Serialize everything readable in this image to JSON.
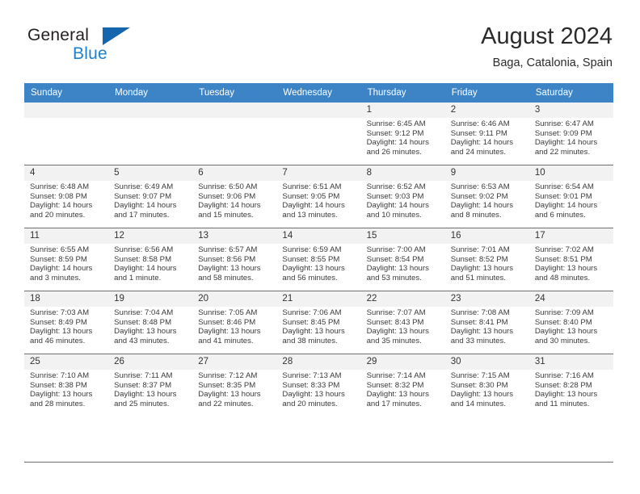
{
  "brand": {
    "name_top": "General",
    "name_bottom": "Blue",
    "flag_icon": "triangle-flag-icon",
    "accent_color": "#1d7fd0"
  },
  "header": {
    "title": "August 2024",
    "location": "Baga, Catalonia, Spain"
  },
  "calendar": {
    "header_bg": "#3c84c6",
    "daynum_bg": "#f2f2f2",
    "weekdays": [
      "Sunday",
      "Monday",
      "Tuesday",
      "Wednesday",
      "Thursday",
      "Friday",
      "Saturday"
    ],
    "weeks": [
      [
        {
          "day": "",
          "empty": true
        },
        {
          "day": "",
          "empty": true
        },
        {
          "day": "",
          "empty": true
        },
        {
          "day": "",
          "empty": true
        },
        {
          "day": "1",
          "sunrise": "Sunrise: 6:45 AM",
          "sunset": "Sunset: 9:12 PM",
          "daylight1": "Daylight: 14 hours",
          "daylight2": "and 26 minutes."
        },
        {
          "day": "2",
          "sunrise": "Sunrise: 6:46 AM",
          "sunset": "Sunset: 9:11 PM",
          "daylight1": "Daylight: 14 hours",
          "daylight2": "and 24 minutes."
        },
        {
          "day": "3",
          "sunrise": "Sunrise: 6:47 AM",
          "sunset": "Sunset: 9:09 PM",
          "daylight1": "Daylight: 14 hours",
          "daylight2": "and 22 minutes."
        }
      ],
      [
        {
          "day": "4",
          "sunrise": "Sunrise: 6:48 AM",
          "sunset": "Sunset: 9:08 PM",
          "daylight1": "Daylight: 14 hours",
          "daylight2": "and 20 minutes."
        },
        {
          "day": "5",
          "sunrise": "Sunrise: 6:49 AM",
          "sunset": "Sunset: 9:07 PM",
          "daylight1": "Daylight: 14 hours",
          "daylight2": "and 17 minutes."
        },
        {
          "day": "6",
          "sunrise": "Sunrise: 6:50 AM",
          "sunset": "Sunset: 9:06 PM",
          "daylight1": "Daylight: 14 hours",
          "daylight2": "and 15 minutes."
        },
        {
          "day": "7",
          "sunrise": "Sunrise: 6:51 AM",
          "sunset": "Sunset: 9:05 PM",
          "daylight1": "Daylight: 14 hours",
          "daylight2": "and 13 minutes."
        },
        {
          "day": "8",
          "sunrise": "Sunrise: 6:52 AM",
          "sunset": "Sunset: 9:03 PM",
          "daylight1": "Daylight: 14 hours",
          "daylight2": "and 10 minutes."
        },
        {
          "day": "9",
          "sunrise": "Sunrise: 6:53 AM",
          "sunset": "Sunset: 9:02 PM",
          "daylight1": "Daylight: 14 hours",
          "daylight2": "and 8 minutes."
        },
        {
          "day": "10",
          "sunrise": "Sunrise: 6:54 AM",
          "sunset": "Sunset: 9:01 PM",
          "daylight1": "Daylight: 14 hours",
          "daylight2": "and 6 minutes."
        }
      ],
      [
        {
          "day": "11",
          "sunrise": "Sunrise: 6:55 AM",
          "sunset": "Sunset: 8:59 PM",
          "daylight1": "Daylight: 14 hours",
          "daylight2": "and 3 minutes."
        },
        {
          "day": "12",
          "sunrise": "Sunrise: 6:56 AM",
          "sunset": "Sunset: 8:58 PM",
          "daylight1": "Daylight: 14 hours",
          "daylight2": "and 1 minute."
        },
        {
          "day": "13",
          "sunrise": "Sunrise: 6:57 AM",
          "sunset": "Sunset: 8:56 PM",
          "daylight1": "Daylight: 13 hours",
          "daylight2": "and 58 minutes."
        },
        {
          "day": "14",
          "sunrise": "Sunrise: 6:59 AM",
          "sunset": "Sunset: 8:55 PM",
          "daylight1": "Daylight: 13 hours",
          "daylight2": "and 56 minutes."
        },
        {
          "day": "15",
          "sunrise": "Sunrise: 7:00 AM",
          "sunset": "Sunset: 8:54 PM",
          "daylight1": "Daylight: 13 hours",
          "daylight2": "and 53 minutes."
        },
        {
          "day": "16",
          "sunrise": "Sunrise: 7:01 AM",
          "sunset": "Sunset: 8:52 PM",
          "daylight1": "Daylight: 13 hours",
          "daylight2": "and 51 minutes."
        },
        {
          "day": "17",
          "sunrise": "Sunrise: 7:02 AM",
          "sunset": "Sunset: 8:51 PM",
          "daylight1": "Daylight: 13 hours",
          "daylight2": "and 48 minutes."
        }
      ],
      [
        {
          "day": "18",
          "sunrise": "Sunrise: 7:03 AM",
          "sunset": "Sunset: 8:49 PM",
          "daylight1": "Daylight: 13 hours",
          "daylight2": "and 46 minutes."
        },
        {
          "day": "19",
          "sunrise": "Sunrise: 7:04 AM",
          "sunset": "Sunset: 8:48 PM",
          "daylight1": "Daylight: 13 hours",
          "daylight2": "and 43 minutes."
        },
        {
          "day": "20",
          "sunrise": "Sunrise: 7:05 AM",
          "sunset": "Sunset: 8:46 PM",
          "daylight1": "Daylight: 13 hours",
          "daylight2": "and 41 minutes."
        },
        {
          "day": "21",
          "sunrise": "Sunrise: 7:06 AM",
          "sunset": "Sunset: 8:45 PM",
          "daylight1": "Daylight: 13 hours",
          "daylight2": "and 38 minutes."
        },
        {
          "day": "22",
          "sunrise": "Sunrise: 7:07 AM",
          "sunset": "Sunset: 8:43 PM",
          "daylight1": "Daylight: 13 hours",
          "daylight2": "and 35 minutes."
        },
        {
          "day": "23",
          "sunrise": "Sunrise: 7:08 AM",
          "sunset": "Sunset: 8:41 PM",
          "daylight1": "Daylight: 13 hours",
          "daylight2": "and 33 minutes."
        },
        {
          "day": "24",
          "sunrise": "Sunrise: 7:09 AM",
          "sunset": "Sunset: 8:40 PM",
          "daylight1": "Daylight: 13 hours",
          "daylight2": "and 30 minutes."
        }
      ],
      [
        {
          "day": "25",
          "sunrise": "Sunrise: 7:10 AM",
          "sunset": "Sunset: 8:38 PM",
          "daylight1": "Daylight: 13 hours",
          "daylight2": "and 28 minutes."
        },
        {
          "day": "26",
          "sunrise": "Sunrise: 7:11 AM",
          "sunset": "Sunset: 8:37 PM",
          "daylight1": "Daylight: 13 hours",
          "daylight2": "and 25 minutes."
        },
        {
          "day": "27",
          "sunrise": "Sunrise: 7:12 AM",
          "sunset": "Sunset: 8:35 PM",
          "daylight1": "Daylight: 13 hours",
          "daylight2": "and 22 minutes."
        },
        {
          "day": "28",
          "sunrise": "Sunrise: 7:13 AM",
          "sunset": "Sunset: 8:33 PM",
          "daylight1": "Daylight: 13 hours",
          "daylight2": "and 20 minutes."
        },
        {
          "day": "29",
          "sunrise": "Sunrise: 7:14 AM",
          "sunset": "Sunset: 8:32 PM",
          "daylight1": "Daylight: 13 hours",
          "daylight2": "and 17 minutes."
        },
        {
          "day": "30",
          "sunrise": "Sunrise: 7:15 AM",
          "sunset": "Sunset: 8:30 PM",
          "daylight1": "Daylight: 13 hours",
          "daylight2": "and 14 minutes."
        },
        {
          "day": "31",
          "sunrise": "Sunrise: 7:16 AM",
          "sunset": "Sunset: 8:28 PM",
          "daylight1": "Daylight: 13 hours",
          "daylight2": "and 11 minutes."
        }
      ]
    ]
  }
}
